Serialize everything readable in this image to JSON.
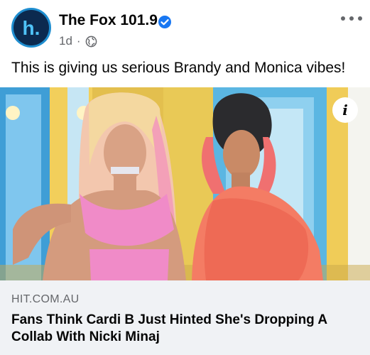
{
  "post": {
    "page_name": "The Fox 101.9",
    "time": "1d",
    "separator": "·",
    "caption": "This is giving us serious Brandy and Monica vibes!"
  },
  "avatar": {
    "letter": "h."
  },
  "link": {
    "domain": "HIT.COM.AU",
    "headline": "Fans Think Cardi B Just Hinted She's Dropping A Collab With Nicki Minaj"
  },
  "info_glyph": "i",
  "colors": {
    "brand_blue": "#1f8ed0",
    "avatar_dark": "#0c2a4f",
    "verified_blue": "#1877f2",
    "secondary_text": "#65676b",
    "link_box_bg": "#f0f2f5"
  },
  "icons": [
    "avatar-logo",
    "verified-badge-icon",
    "globe-icon",
    "more-options-icon",
    "info-icon"
  ]
}
